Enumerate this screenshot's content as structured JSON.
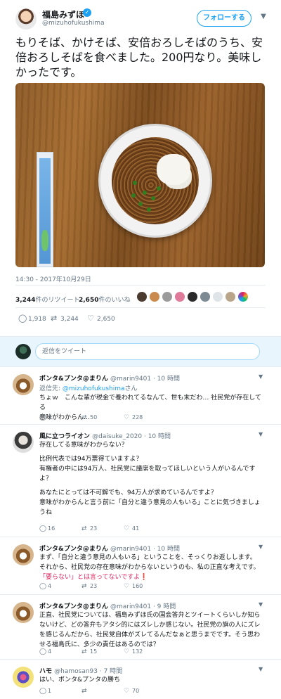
{
  "main_tweet": {
    "author_name": "福島みずほ",
    "author_handle": "@mizuhofukushima",
    "follow_label": "フォローする",
    "text": "もりそば、かけそば、安倍おろしそばのうち、安倍おろしそばを食べました。200円なり。美味しかったです。",
    "timestamp": "14:30 - 2017年10月29日",
    "retweet_count": "3,244",
    "retweet_label": "件のリツイート",
    "like_count": "2,650",
    "like_label": "件のいいね",
    "actions": {
      "replies": "1,918",
      "retweets": "3,244",
      "likes": "2,650"
    }
  },
  "reply_box": {
    "placeholder": "返信をツイート"
  },
  "replies": [
    {
      "name": "ポンタ&プンタ@まりん",
      "handle": "@marin9401 · 10 時間",
      "reply_to_prefix": "返信先: ",
      "reply_to_handle": "@mizuhofukushima",
      "reply_to_suffix": "さん",
      "lines": [
        "ちょｗ　こんな輩が税金で養われてるなんて、世も末だわ… 社民党が存在してる",
        "意味がわからん…"
      ],
      "replies": "3",
      "retweets": "50",
      "likes": "228"
    },
    {
      "name": "風に立つライオン",
      "handle": "@daisuke_2020 · 10 時間",
      "lines": [
        "存在してる意味がわからない？",
        "",
        "比例代表では94万票得ていますよ？",
        "有権者の中には94万人、社民党に議席を取ってほしいという人がいるんです",
        "よ？",
        "",
        "あなたにとっては不可解でも、94万人が求めているんですよ？",
        "意味がわからんと言う前に「自分と違う意見の人もいる」ことに気づきましょ",
        "うね"
      ],
      "replies": "16",
      "retweets": "23",
      "likes": "41"
    },
    {
      "name": "ポンタ&プンタ@まりん",
      "handle": "@marin9401 · 10 時間",
      "lines": [
        "まず、「自分と違う意見の人もいる」ということを、そっくりお返しします。",
        "それから、社民党の存在意味がわからないというのも、私の正直な考えです。",
        "「要らない」とは言ってないですよ❗"
      ],
      "replies": "4",
      "retweets": "23",
      "likes": "160"
    },
    {
      "name": "ポンタ&プンタ@まりん",
      "handle": "@marin9401 · 9 時間",
      "lines": [
        "正直、社民党については、福島みずほ氏の国会答弁とツイートくらいしか知ら",
        "ないけど、どの答弁もアタシ的にはズレしか感じない。社民党の旗の人にズレ",
        "を感じるんだから、社民党自体がズレてるんだなぁと思うまでです。そう思わ",
        "せる福島氏に、多少の責任はあるのでは？"
      ],
      "replies": "4",
      "retweets": "15",
      "likes": "132"
    },
    {
      "name": "ハモ",
      "handle": "@hamosan93 · 7 時間",
      "lines": [
        "はい、ポンタ&プンタの勝ち"
      ],
      "replies": "1",
      "retweets": "",
      "likes": "70"
    }
  ],
  "colors": {
    "accent": "#1da1f2",
    "muted": "#657786",
    "like_red": "#e0245e"
  },
  "icons": [
    "verified-icon",
    "chevron-down-icon",
    "reply-icon",
    "retweet-icon",
    "like-icon"
  ]
}
